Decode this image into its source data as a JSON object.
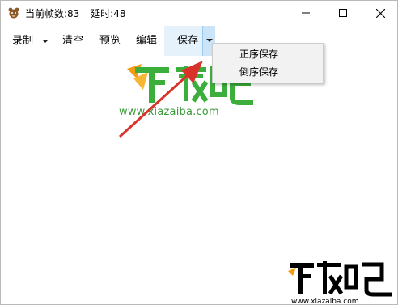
{
  "window": {
    "title_frames": "当前帧数:83",
    "title_delay": "延时:48",
    "controls": {
      "minimize": "minimize-icon",
      "maximize": "maximize-icon",
      "close": "close-icon"
    }
  },
  "toolbar": {
    "record_label": "录制",
    "clear_label": "清空",
    "preview_label": "预览",
    "edit_label": "编辑",
    "save_label": "保存"
  },
  "save_menu": {
    "items": [
      {
        "label": "正序保存"
      },
      {
        "label": "倒序保存"
      }
    ]
  },
  "watermark": {
    "center_url": "www.xiazaiba.com",
    "corner_url": "www.xiazaiba.com",
    "logo_text": "下载吧"
  },
  "colors": {
    "hover_bg": "#e5f1fb",
    "menu_bg": "#f2f2f2",
    "watermark_green": "#3a9a3a",
    "watermark_orange": "#f39c12",
    "arrow_red": "#d9322b"
  }
}
